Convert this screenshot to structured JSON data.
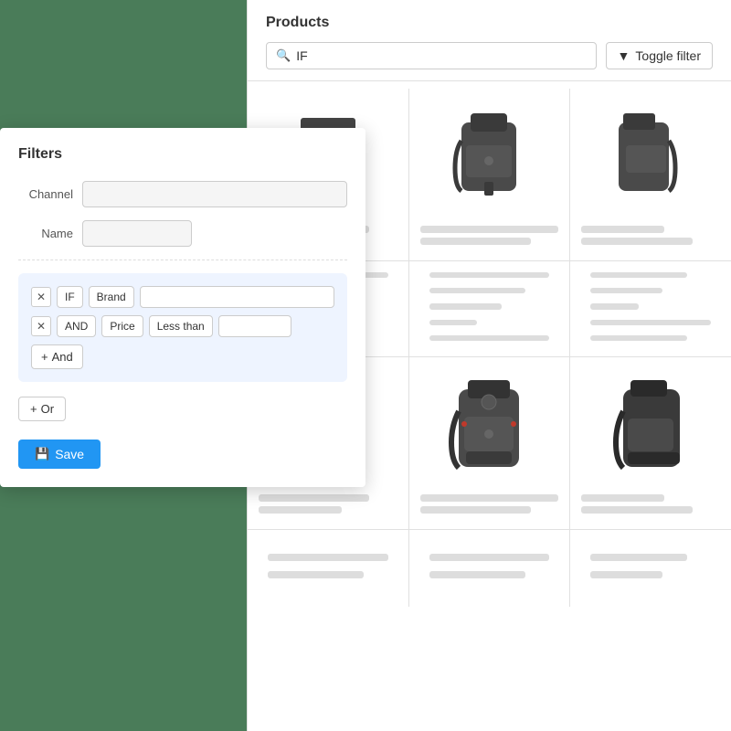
{
  "page": {
    "background_color": "#4a7c59"
  },
  "products_panel": {
    "title": "Products",
    "search_value": "IF",
    "search_placeholder": "IF",
    "toggle_filter_label": "Toggle filter",
    "filter_icon": "▼"
  },
  "filters_panel": {
    "title": "Filters",
    "channel_label": "Channel",
    "channel_placeholder": "",
    "name_label": "Name",
    "name_placeholder": "",
    "condition_1": {
      "connector": "IF",
      "field": "Brand",
      "operator": "",
      "value_placeholder": ""
    },
    "condition_2": {
      "connector": "AND",
      "field": "Price",
      "operator": "Less than",
      "value_placeholder": ""
    },
    "add_and_label": "And",
    "or_label": "Or",
    "save_label": "Save"
  }
}
